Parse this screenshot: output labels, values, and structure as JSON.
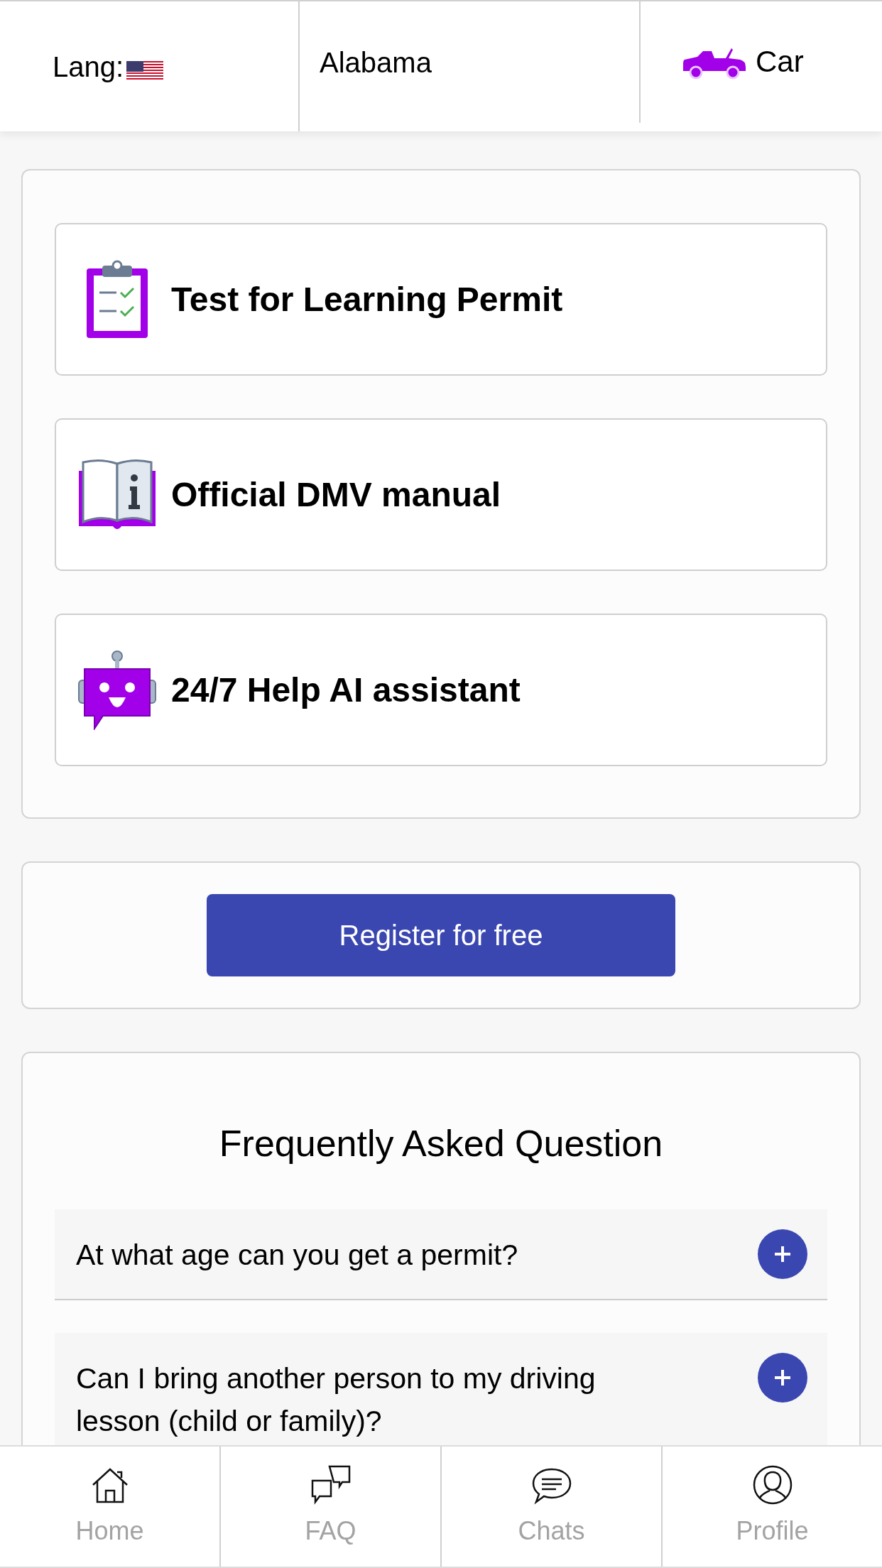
{
  "top_bar": {
    "language_label": "Lang:",
    "state": "Alabama",
    "vehicle": "Car"
  },
  "menu": [
    {
      "kind": "test",
      "label": "Test for Learning Permit"
    },
    {
      "kind": "manual",
      "label": "Official DMV manual"
    },
    {
      "kind": "assistant",
      "label": "24/7 Help AI assistant"
    }
  ],
  "register_button": "Register for free",
  "faq": {
    "title": "Frequently Asked Question",
    "items": [
      {
        "question": "At what age can you get a permit?",
        "expanded": false
      },
      {
        "question": "Can I bring another person to my driving lesson (child or family)?",
        "expanded": false
      }
    ]
  },
  "bottom_nav": [
    {
      "kind": "home",
      "label": "Home",
      "selected": false
    },
    {
      "kind": "faq",
      "label": "FAQ",
      "selected": false
    },
    {
      "kind": "chats",
      "label": "Chats",
      "selected": false
    },
    {
      "kind": "profile",
      "label": "Profile",
      "selected": false
    }
  ]
}
